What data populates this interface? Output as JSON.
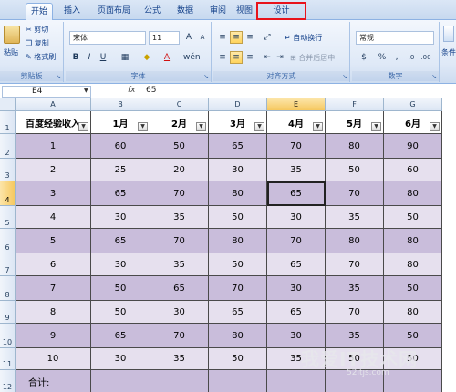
{
  "tabs": [
    "开始",
    "插入",
    "页面布局",
    "公式",
    "数据",
    "审阅",
    "视图",
    "设计"
  ],
  "ribbon": {
    "clipboard": {
      "paste": "粘贴",
      "cut": "剪切",
      "copy": "复制",
      "format_painter": "格式刷",
      "label": "剪贴板"
    },
    "font": {
      "name": "宋体",
      "size": "11",
      "label": "字体"
    },
    "alignment": {
      "wrap": "自动换行",
      "merge": "合并后居中",
      "label": "对齐方式"
    },
    "number": {
      "format": "常规",
      "label": "数字"
    },
    "styles": {
      "conditional": "条件"
    }
  },
  "formula_bar": {
    "cell_ref": "E4",
    "fx": "fx",
    "value": "65"
  },
  "columns": [
    "A",
    "B",
    "C",
    "D",
    "E",
    "F",
    "G"
  ],
  "rows": [
    "1",
    "2",
    "3",
    "4",
    "5",
    "6",
    "7",
    "8",
    "9",
    "10",
    "11",
    "12"
  ],
  "table": {
    "headers": [
      "百度经验收入",
      "1月",
      "2月",
      "3月",
      "4月",
      "5月",
      "6月"
    ],
    "body": [
      [
        "1",
        "60",
        "50",
        "65",
        "70",
        "80",
        "90"
      ],
      [
        "2",
        "25",
        "20",
        "30",
        "35",
        "50",
        "60"
      ],
      [
        "3",
        "65",
        "70",
        "80",
        "65",
        "70",
        "80"
      ],
      [
        "4",
        "30",
        "35",
        "50",
        "30",
        "35",
        "50"
      ],
      [
        "5",
        "65",
        "70",
        "80",
        "70",
        "80",
        "80"
      ],
      [
        "6",
        "30",
        "35",
        "50",
        "65",
        "70",
        "80"
      ],
      [
        "7",
        "50",
        "65",
        "70",
        "30",
        "35",
        "50"
      ],
      [
        "8",
        "50",
        "30",
        "65",
        "65",
        "70",
        "80"
      ],
      [
        "9",
        "65",
        "70",
        "80",
        "30",
        "35",
        "50"
      ],
      [
        "10",
        "30",
        "35",
        "50",
        "35",
        "50",
        "50"
      ]
    ],
    "total_label": "合计:"
  },
  "watermark": {
    "text": "我爱IT技术网",
    "url": "52itjs.com"
  }
}
